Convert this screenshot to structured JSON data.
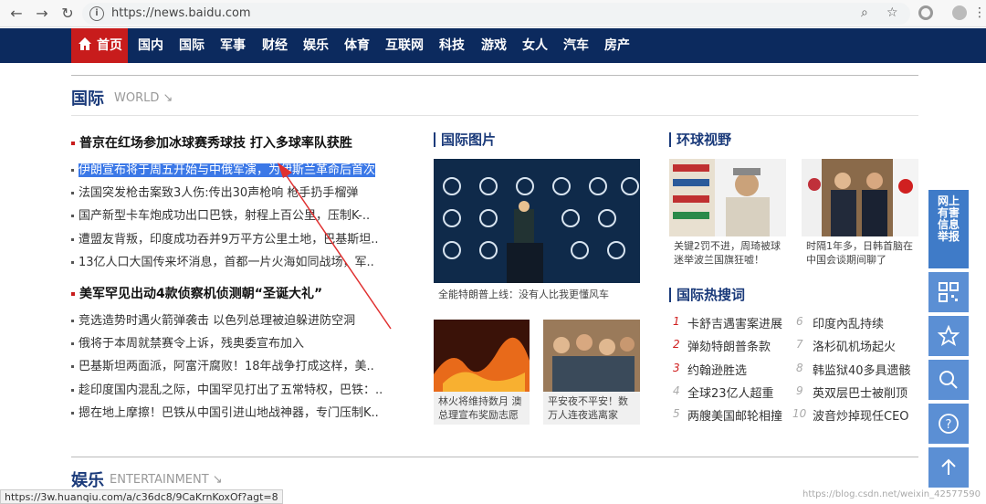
{
  "browser": {
    "url": "https://news.baidu.com",
    "status_url": "https://3w.huanqiu.com/a/c36dc8/9CaKrnKoxOf?agt=8"
  },
  "nav": {
    "home": "首页",
    "items": [
      "国内",
      "国际",
      "军事",
      "财经",
      "娱乐",
      "体育",
      "互联网",
      "科技",
      "游戏",
      "女人",
      "汽车",
      "房产"
    ]
  },
  "section_world": {
    "title": "国际",
    "subtitle": "WORLD ↘"
  },
  "section_ent": {
    "title": "娱乐",
    "subtitle": "ENTERTAINMENT ↘"
  },
  "news": {
    "headline1": "普京在红场参加冰球赛秀球技 打入多球率队获胜",
    "list1": [
      "伊朗宣布将于周五开始与中俄军演，为伊斯兰革命后首次",
      "法国突发枪击案致3人伤:传出30声枪响 枪手扔手榴弹",
      "国产新型卡车炮成功出口巴铁，射程上百公里，压制K-..",
      "遭盟友背叛，印度成功吞并9万平方公里土地，巴基斯坦..",
      "13亿人口大国传来坏消息，首都一片火海如同战场，军.."
    ],
    "headline2": "美军罕见出动4款侦察机侦测朝“圣诞大礼”",
    "list2": [
      "竞选造势时遇火箭弹袭击 以色列总理被迫躲进防空洞",
      "俄将于本周就禁赛令上诉，残奥委宣布加入",
      "巴基斯坦两面派，阿富汗腐败！18年战争打成这样，美..",
      "趁印度国内混乱之际，中国罕见打出了五常特权，巴铁：..",
      "摁在地上摩擦！巴铁从中国引进山地战神器，专门压制K.."
    ]
  },
  "photos": {
    "title": "国际图片",
    "main_caption": "全能特朗普上线：没有人比我更懂风车",
    "small": [
      {
        "caption": "林火将维持数月 澳总理宣布奖励志愿"
      },
      {
        "caption": "平安夜不平安！数万人连夜逃离家"
      }
    ]
  },
  "global_view": {
    "title": "环球视野",
    "items": [
      {
        "caption": "关键2罚不进，周琦被球迷举波兰国旗狂嘘！"
      },
      {
        "caption": "时隔1年多，日韩首脑在中国会谈期间聊了"
      }
    ]
  },
  "hot_search": {
    "title": "国际热搜词",
    "left": [
      {
        "rank": "1",
        "text": "卡舒吉遇害案进展"
      },
      {
        "rank": "2",
        "text": "弹劾特朗普条款"
      },
      {
        "rank": "3",
        "text": "约翰逊胜选"
      },
      {
        "rank": "4",
        "text": "全球23亿人超重"
      },
      {
        "rank": "5",
        "text": "两艘美国邮轮相撞"
      }
    ],
    "right": [
      {
        "rank": "6",
        "text": "印度內乱持续"
      },
      {
        "rank": "7",
        "text": "洛杉矶机场起火"
      },
      {
        "rank": "8",
        "text": "韩监狱40多具遗骸"
      },
      {
        "rank": "9",
        "text": "英双层巴士被削顶"
      },
      {
        "rank": "10",
        "text": "波音炒掉现任CEO"
      }
    ]
  },
  "sidebar": {
    "report": "网上有害信息举报"
  },
  "watermark": "https://blog.csdn.net/weixin_42577590",
  "colors": {
    "nav_bg": "#0c2a5e",
    "home_bg": "#c81c1c",
    "title": "#1a3a7a",
    "sidebar": "#3f7bc8"
  }
}
